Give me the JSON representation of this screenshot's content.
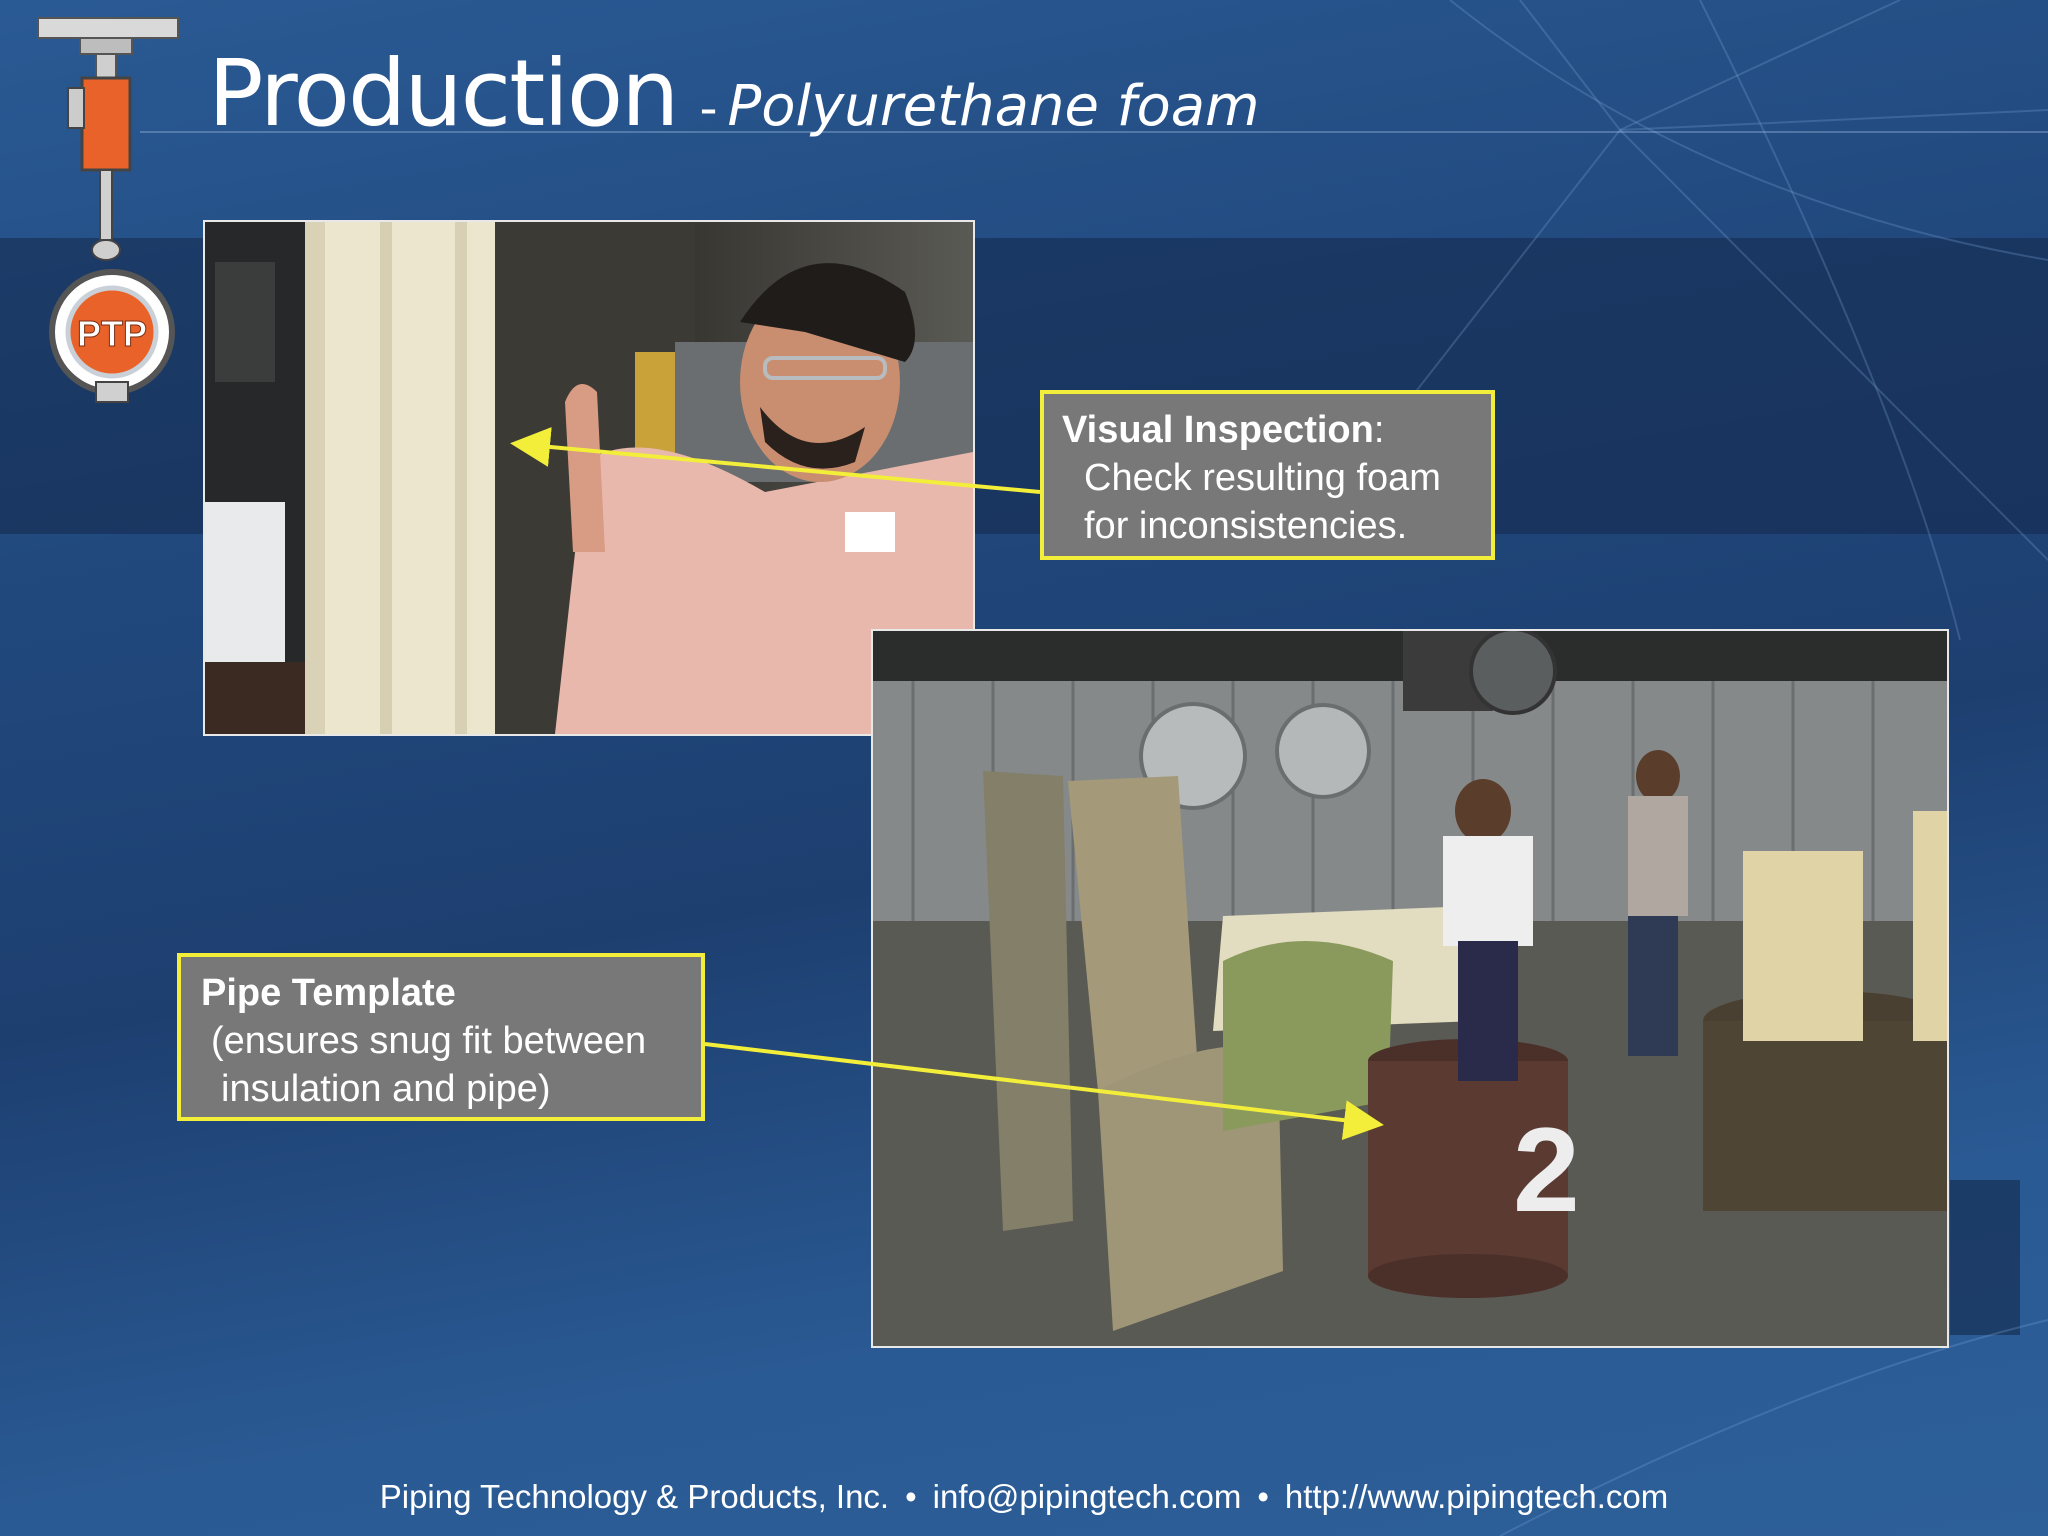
{
  "slide": {
    "title": "Production",
    "separator": "-",
    "subtitle": "Polyurethane foam"
  },
  "logo": {
    "text": "PTP",
    "icon": "valve-logo-icon"
  },
  "photos": {
    "inspection_photo": "foam-inspection-photo",
    "template_photo": "pipe-template-photo",
    "template_number": "2"
  },
  "callouts": {
    "visual_inspection": {
      "heading": "Visual Inspection",
      "colon": ":",
      "line2": "Check resulting foam",
      "line3": "for inconsistencies."
    },
    "pipe_template": {
      "heading": "Pipe Template",
      "line2": "(ensures snug fit between",
      "line3": "insulation and pipe)"
    }
  },
  "footer": {
    "company": "Piping Technology & Products, Inc.",
    "bullet": "•",
    "email": "info@pipingtech.com",
    "website": "http://www.pipingtech.com"
  },
  "colors": {
    "callout_border": "#f2ee3a",
    "callout_fill": "#787878",
    "background": "#21497e",
    "logo_orange": "#e8622a"
  }
}
